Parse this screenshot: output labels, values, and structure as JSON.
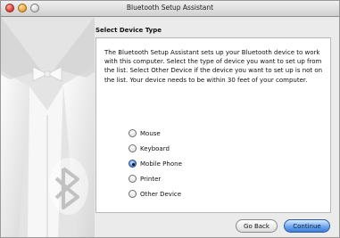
{
  "window": {
    "title": "Bluetooth Setup Assistant"
  },
  "section": {
    "title": "Select Device Type"
  },
  "content": {
    "description": "The Bluetooth Setup Assistant sets up your Bluetooth device to work with this computer. Select the type of device you want to set up from the list. Select Other Device if the device you want to set up is not on the list. Your device needs to be within 30 feet of your computer.",
    "options": [
      {
        "label": "Mouse",
        "checked": false
      },
      {
        "label": "Keyboard",
        "checked": false
      },
      {
        "label": "Mobile Phone",
        "checked": true
      },
      {
        "label": "Printer",
        "checked": false
      },
      {
        "label": "Other Device",
        "checked": false
      }
    ]
  },
  "buttons": {
    "back": "Go Back",
    "continue": "Continue"
  },
  "icons": [
    "close-icon",
    "minimize-icon",
    "zoom-icon",
    "bluetooth-icon",
    "bow-tie-icon"
  ],
  "colors": {
    "accent": "#4a86d8"
  }
}
